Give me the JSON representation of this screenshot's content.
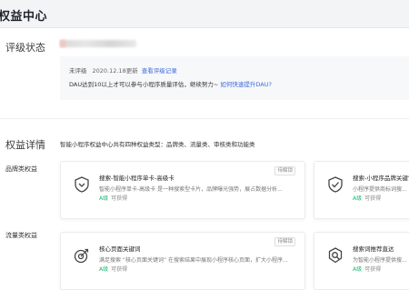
{
  "header": {
    "title": "权益中心"
  },
  "rating": {
    "section_title": "评级状态",
    "status": "未评级",
    "date": "2020.12.18更新",
    "view_link": "查看评级记录",
    "notice": "DAU达到10以上才可以参与小程序质量评估，继续努力~ ",
    "notice_link": "如何快速提升DAU?"
  },
  "details": {
    "section_title": "权益详情",
    "description": "智能小程序权益中心共有四种权益类型：品牌类、流量类、审核类和功能类"
  },
  "brand": {
    "label": "品牌类权益",
    "cards": [
      {
        "tag": "待解锁",
        "name": "搜索-智能小程序单卡-高级卡",
        "sub": "智能小程序单卡-高级卡 是一种搜索型卡片，品牌曝光强势，展占数据分析...",
        "grade": "A级",
        "state": "可获得",
        "icon": "heart-shield-icon"
      },
      {
        "tag": "",
        "name": "搜索-小程序品牌关键词",
        "sub": "小程序提供商标词搜...",
        "grade": "A级",
        "state": "可获得",
        "icon": "check-shield-icon"
      }
    ]
  },
  "traffic": {
    "label": "流量类权益",
    "cards": [
      {
        "tag": "待解锁",
        "name": "核心页面关键词",
        "sub": "满足搜索 “核心页面关键词” 在搜索结果中展现小程序核心页面，扩大小程序...",
        "grade": "A级",
        "state": "可获得",
        "icon": "target-icon"
      },
      {
        "tag": "",
        "name": "搜索词推荐直达",
        "sub": "为智能小程序提供搜...",
        "grade": "A级",
        "state": "可获得",
        "icon": "search-target-icon"
      }
    ]
  },
  "colors": {
    "accent": "#3e6bd6",
    "grade": "#15b76e",
    "card_bg": "#f7f8fa"
  }
}
